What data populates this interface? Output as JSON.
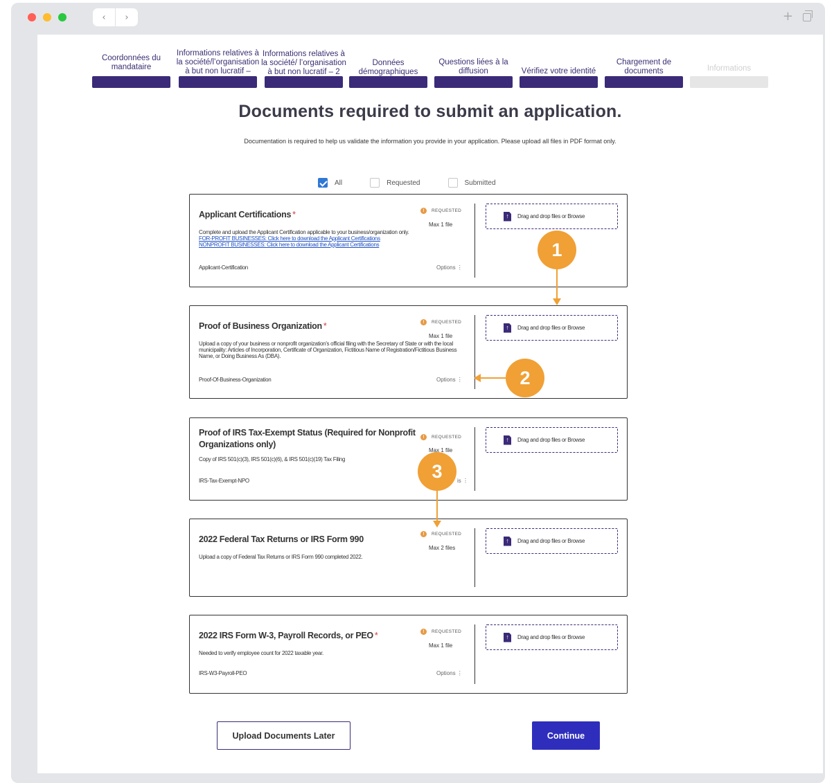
{
  "steps": [
    {
      "label": "Coordonnées du mandataire"
    },
    {
      "label": "Informations relatives à la société/l’organisation à but non lucratif –"
    },
    {
      "label": "Informations relatives à la société/ l’organisation à but non lucratif – 2"
    },
    {
      "label": "Données démographiques"
    },
    {
      "label": "Questions liées à la diffusion"
    },
    {
      "label": "Vérifiez votre identité"
    },
    {
      "label": "Chargement de documents"
    },
    {
      "label": "Informations"
    }
  ],
  "page": {
    "title": "Documents required to submit an application.",
    "subtitle": "Documentation is required to help us validate the information you provide in your application. Please upload all files in PDF format only."
  },
  "filters": [
    {
      "label": "All",
      "checked": true
    },
    {
      "label": "Requested",
      "checked": false
    },
    {
      "label": "Submitted",
      "checked": false
    }
  ],
  "common": {
    "requested": "REQUESTED",
    "options": "Options ⋮",
    "dropzone": "Drag and drop files or Browse",
    "required_mark": "*",
    "badge_glyph": "!"
  },
  "documents": [
    {
      "title": "Applicant Certifications",
      "required": true,
      "max": "Max 1 file",
      "description": "Complete and upload the Applicant Certification applicable to your business/organization only.",
      "links": [
        "FOR-PROFIT BUSINESSES: Click here to download the Applicant Certifications",
        "NONPROFIT BUSINESSES: Click here to download the Applicant Certifications"
      ],
      "identifier": "Applicant-Certification"
    },
    {
      "title": "Proof of Business Organization",
      "required": true,
      "max": "Max 1 file",
      "description": "Upload a copy of your business or nonprofit organization's official filing with the Secretary of State or with the local municipality: Articles of Incorporation, Certificate of Organization, Fictitious Name of Registration/Fictitious Business Name, or Doing Business As (DBA).",
      "identifier": "Proof-Of-Business-Organization"
    },
    {
      "title": "Proof of IRS Tax-Exempt Status (Required for Nonprofit Organizations only)",
      "required": false,
      "max": "Max 1 file",
      "description": "Copy of IRS 501(c)(3), IRS 501(c)(6), & IRS 501(c)(19) Tax Filing",
      "identifier": "IRS-Tax-Exempt-NPO",
      "options_partial": "is ⋮"
    },
    {
      "title": "2022 Federal Tax Returns or IRS Form 990",
      "required": false,
      "max": "Max 2 files",
      "description": "Upload a copy of Federal Tax Returns or IRS Form 990 completed 2022."
    },
    {
      "title": "2022 IRS Form W-3, Payroll Records, or PEO",
      "required": true,
      "max": "Max 1 file",
      "description": "Needed to verify employee count for 2022 taxable year.",
      "identifier": "IRS-W3-Payroll-PEO"
    }
  ],
  "annotations": [
    "1",
    "2",
    "3"
  ],
  "buttons": {
    "later": "Upload Documents Later",
    "continue": "Continue"
  },
  "colors": {
    "brand": "#3b2a78",
    "continue": "#2f2ebc",
    "annotation": "#f0a035",
    "required": "#d23b3b"
  }
}
